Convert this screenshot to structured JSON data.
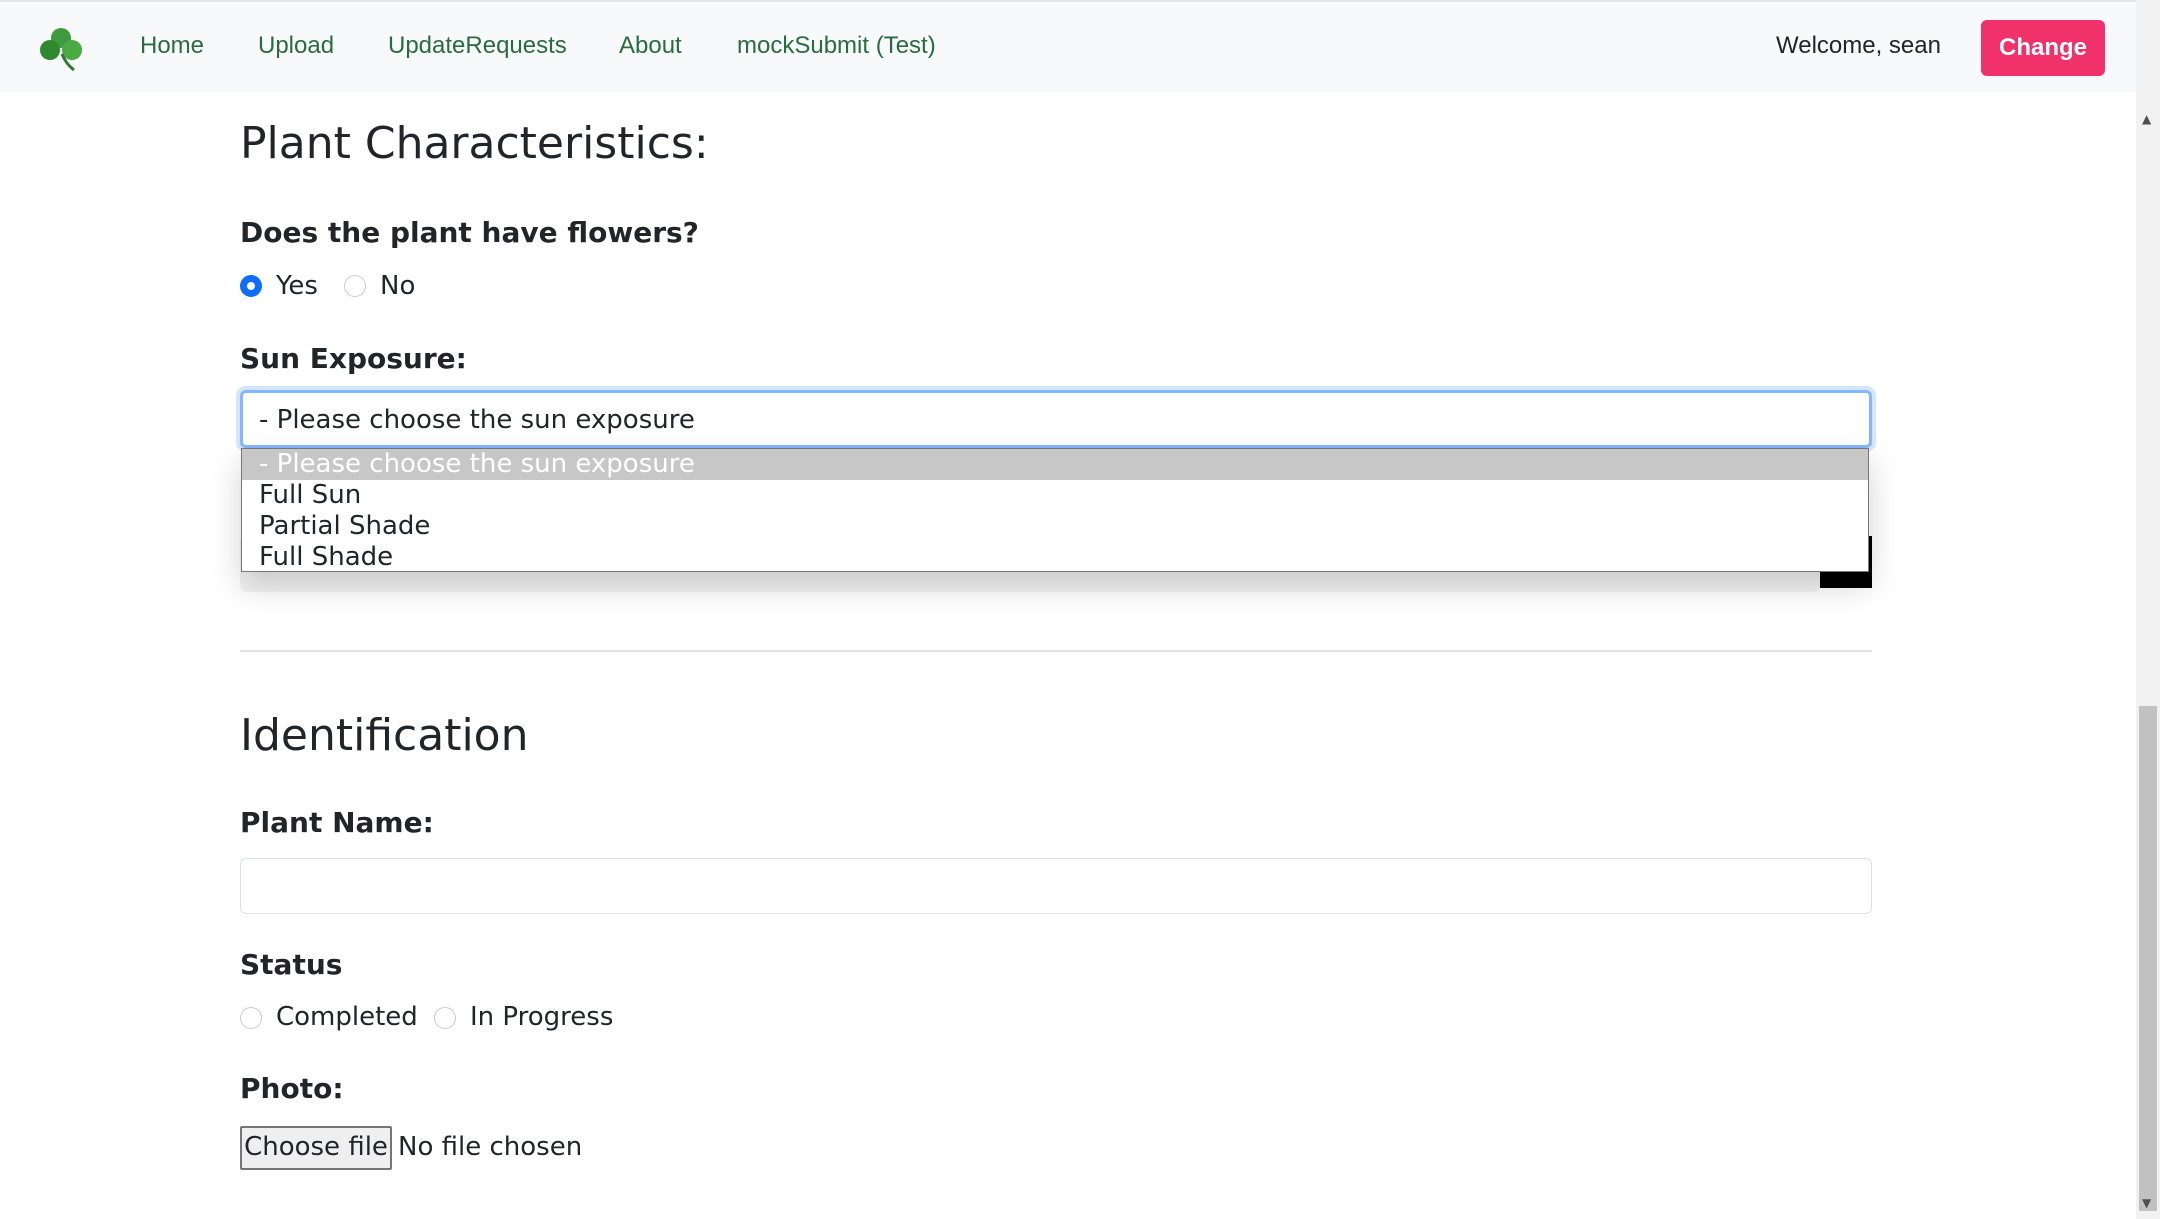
{
  "navbar": {
    "logo_icon": "shamrock-icon",
    "links": [
      "Home",
      "Upload",
      "UpdateRequests",
      "About",
      "mockSubmit (Test)"
    ],
    "welcome": "Welcome, sean",
    "change_label": "Change",
    "link_color": "#2a6b41",
    "button_color": "#f0316a"
  },
  "characteristics": {
    "heading": "Plant Characteristics:",
    "flowers_question": "Does the plant have flowers?",
    "flower_options": [
      "Yes",
      "No"
    ],
    "flower_selected": "Yes",
    "sun_label": "Sun Exposure:",
    "sun_selected": "- Please choose the sun exposure",
    "sun_options": [
      "- Please choose the sun exposure",
      "Full Sun",
      "Partial Shade",
      "Full Shade"
    ]
  },
  "identification": {
    "heading": "Identification",
    "plant_name_label": "Plant Name:",
    "plant_name_value": "",
    "status_label": "Status",
    "status_options": [
      "Completed",
      "In Progress"
    ],
    "photo_label": "Photo:",
    "choose_file_label": "Choose file",
    "file_status": "No file chosen"
  }
}
